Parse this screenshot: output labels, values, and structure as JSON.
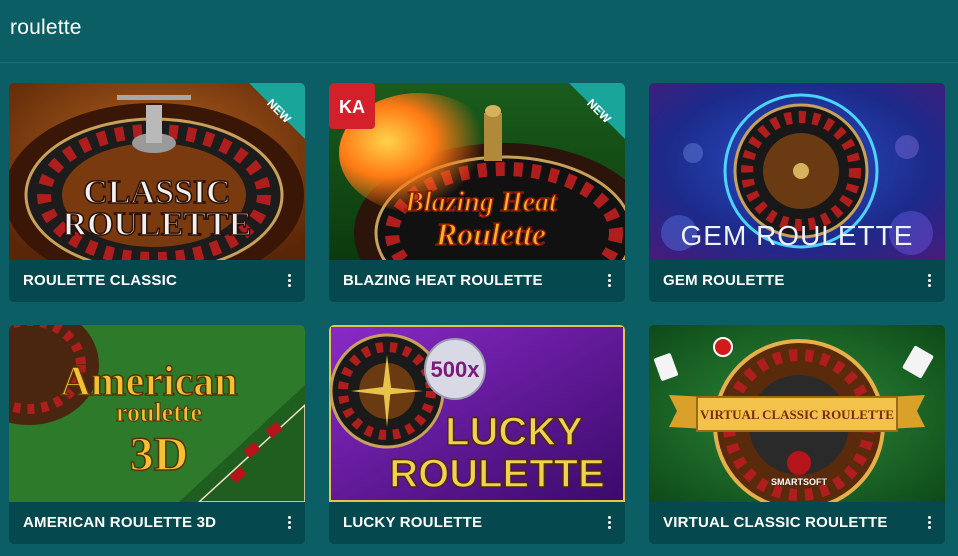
{
  "search": {
    "query": "roulette"
  },
  "games": [
    {
      "title": "ROULETTE CLASSIC",
      "art_line1": "CLASSIC",
      "art_line2": "ROULETTE",
      "badge": "NEW"
    },
    {
      "title": "BLAZING HEAT ROULETTE",
      "art_line1": "Blazing Heat",
      "art_line2": "Roulette",
      "badge": "NEW",
      "provider_logo": "KA"
    },
    {
      "title": "GEM ROULETTE",
      "art_line1": "GEM ROULETTE"
    },
    {
      "title": "AMERICAN ROULETTE 3D",
      "art_line1": "American",
      "art_line2": "roulette",
      "art_line3": "3D"
    },
    {
      "title": "LUCKY ROULETTE",
      "art_line1": "LUCKY",
      "art_line2": "ROULETTE",
      "multiplier": "500x"
    },
    {
      "title": "VIRTUAL CLASSIC ROULETTE",
      "art_line1": "VIRTUAL CLASSIC ROULETTE",
      "provider": "SMARTSOFT"
    }
  ],
  "icons": {
    "more": "kebab-menu-icon"
  },
  "colors": {
    "background": "#0b5e63",
    "card_footer": "#05484d",
    "badge": "#1aa59b"
  }
}
